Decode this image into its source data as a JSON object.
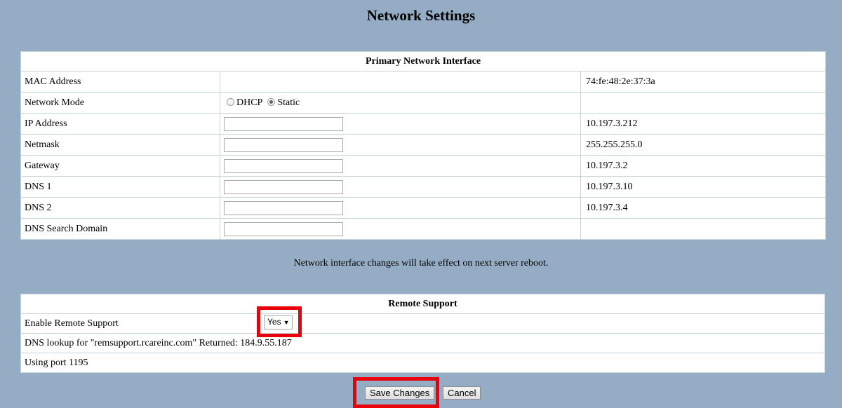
{
  "page": {
    "title": "Network Settings"
  },
  "network": {
    "header": "Primary Network Interface",
    "mac": {
      "label": "MAC Address",
      "current": "74:fe:48:2e:37:3a"
    },
    "mode": {
      "label": "Network Mode",
      "options": [
        "DHCP",
        "Static"
      ],
      "selected": "Static"
    },
    "ip": {
      "label": "IP Address",
      "value": "",
      "current": "10.197.3.212"
    },
    "netmask": {
      "label": "Netmask",
      "value": "",
      "current": "255.255.255.0"
    },
    "gateway": {
      "label": "Gateway",
      "value": "",
      "current": "10.197.3.2"
    },
    "dns1": {
      "label": "DNS 1",
      "value": "",
      "current": "10.197.3.10"
    },
    "dns2": {
      "label": "DNS 2",
      "value": "",
      "current": "10.197.3.4"
    },
    "search_domain": {
      "label": "DNS Search Domain",
      "value": ""
    },
    "note": "Network interface changes will take effect on next server reboot."
  },
  "remote": {
    "header": "Remote Support",
    "enable_label": "Enable Remote Support",
    "enable_value": "Yes",
    "dns_lookup": "DNS lookup for \"remsupport.rcareinc.com\" Returned: 184.9.55.187",
    "port_text": "Using port 1195"
  },
  "buttons": {
    "save": "Save Changes",
    "cancel": "Cancel"
  },
  "colors": {
    "background": "#94acc4",
    "highlight": "#e8000b"
  }
}
